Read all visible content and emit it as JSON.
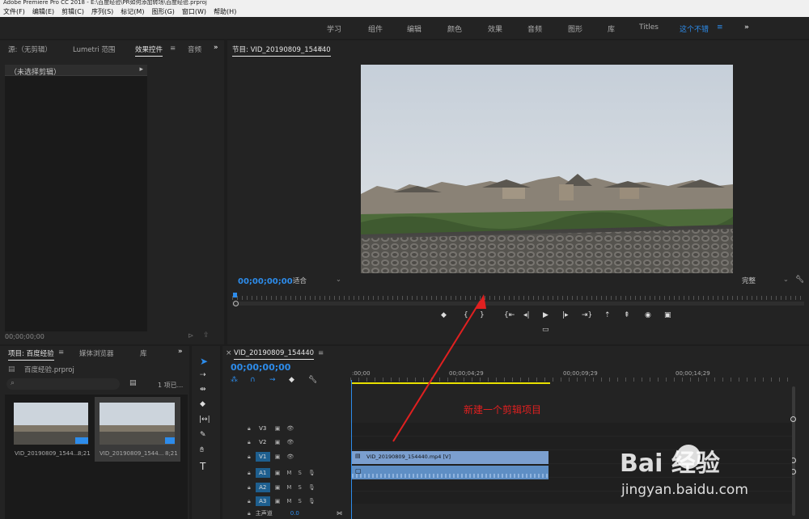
{
  "window": {
    "title": "Adobe Premiere Pro CC 2018 - E:\\百度经验\\PR如何添加转场\\百度经验.prproj"
  },
  "menu": [
    "文件(F)",
    "编辑(E)",
    "剪辑(C)",
    "序列(S)",
    "标记(M)",
    "图形(G)",
    "窗口(W)",
    "帮助(H)"
  ],
  "workspaces": [
    "学习",
    "组件",
    "编辑",
    "颜色",
    "效果",
    "音频",
    "图形",
    "库",
    "Titles",
    "这个不错"
  ],
  "workspace_active": "这个不错",
  "workspace_more": "»",
  "source_panel": {
    "tabs": [
      "源:（无剪辑）",
      "Lumetri 范围",
      "效果控件",
      "音频"
    ],
    "active_tab": "效果控件",
    "no_clip": "（未选择剪辑）",
    "timecode": "00;00;00;00"
  },
  "program_monitor": {
    "title": "节目: VID_20190809_154440",
    "timecode": "00;00;00;00",
    "fit": "适合",
    "quality": "完整"
  },
  "project_panel": {
    "tabs": [
      "项目: 百度经验",
      "媒体浏览器",
      "库"
    ],
    "active_tab": "项目: 百度经验",
    "project_file": "百度经验.prproj",
    "item_count": "1 项已...",
    "items": [
      {
        "name": "VID_20190809_1544...",
        "duration": "8;21"
      },
      {
        "name": "VID_20190809_1544...",
        "duration": "8;21"
      }
    ]
  },
  "timeline": {
    "sequence": "VID_20190809_154440",
    "timecode": "00;00;00;00",
    "ruler": [
      ":00;00",
      "00;00;04;29",
      "00;00;09;29",
      "00;00;14;29"
    ],
    "tracks": [
      {
        "name": "V3",
        "type": "video",
        "targeted": false
      },
      {
        "name": "V2",
        "type": "video",
        "targeted": false
      },
      {
        "name": "V1",
        "type": "video",
        "targeted": true
      },
      {
        "name": "A1",
        "type": "audio",
        "targeted": true
      },
      {
        "name": "A2",
        "type": "audio",
        "targeted": true
      },
      {
        "name": "A3",
        "type": "audio",
        "targeted": true
      }
    ],
    "master": {
      "label": "主声道",
      "value": "0.0"
    },
    "video_clip": "VID_20190809_154440.mp4 [V]"
  },
  "annotation": {
    "text": "新建一个剪辑项目",
    "color": "#e02020"
  },
  "watermark": {
    "brand": "Bai  经验",
    "url": "jingyan.baidu.com"
  },
  "colors": {
    "accent": "#2d8ceb",
    "clip_video": "#7b9fcf",
    "clip_audio": "#5e8ec4",
    "workarea": "#e8e000"
  }
}
